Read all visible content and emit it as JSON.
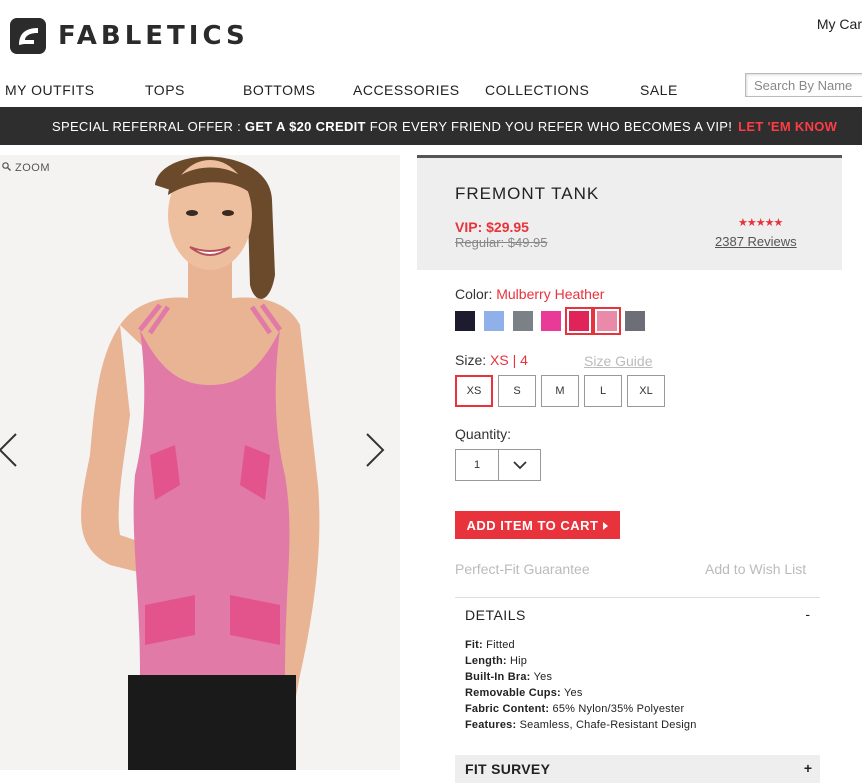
{
  "header": {
    "brand": "FABLETICS",
    "cart_label": "My Car"
  },
  "nav": {
    "items": [
      "MY OUTFITS",
      "TOPS",
      "BOTTOMS",
      "ACCESSORIES",
      "COLLECTIONS",
      "SALE"
    ],
    "search_placeholder": "Search By Name"
  },
  "promo": {
    "prefix": "SPECIAL REFERRAL OFFER : ",
    "bold": "GET A $20 CREDIT",
    "middle": " FOR EVERY FRIEND YOU REFER WHO BECOMES A VIP!",
    "cta": "LET 'EM KNOW"
  },
  "gallery": {
    "zoom_label": "ZOOM"
  },
  "product": {
    "title": "FREMONT TANK",
    "vip_price": "VIP: $29.95",
    "regular_price": "Regular: $49.95",
    "stars": "★★★★★",
    "reviews": "2387 Reviews",
    "color_label": "Color: ",
    "color_value": "Mulberry Heather",
    "swatches": [
      "#1c1c2e",
      "#8fb0e8",
      "#7a8288",
      "#e83a96",
      "#e0245a",
      "#e88aa8",
      "#6e6e78"
    ],
    "size_label": "Size: ",
    "size_value": "XS | 4",
    "size_guide": "Size Guide",
    "sizes": [
      "XS",
      "S",
      "M",
      "L",
      "XL"
    ],
    "quantity_label": "Quantity:",
    "quantity_value": "1",
    "add_to_cart": "ADD ITEM TO CART",
    "perfect_fit": "Perfect-Fit Guarantee",
    "wishlist": "Add to Wish List",
    "details_heading": "DETAILS",
    "details_toggle": "-",
    "specs": [
      {
        "k": "Fit:",
        "v": " Fitted"
      },
      {
        "k": "Length:",
        "v": " Hip"
      },
      {
        "k": "Built-In Bra:",
        "v": " Yes"
      },
      {
        "k": "Removable Cups:",
        "v": " Yes"
      },
      {
        "k": "Fabric Content:",
        "v": " 65% Nylon/35% Polyester"
      },
      {
        "k": "Features:",
        "v": " Seamless, Chafe-Resistant Design"
      }
    ],
    "fit_survey_heading": "FIT SURVEY",
    "fit_survey_toggle": "+"
  },
  "colors": {
    "accent": "#e8323c",
    "promo_bg": "#2e2e2e"
  }
}
